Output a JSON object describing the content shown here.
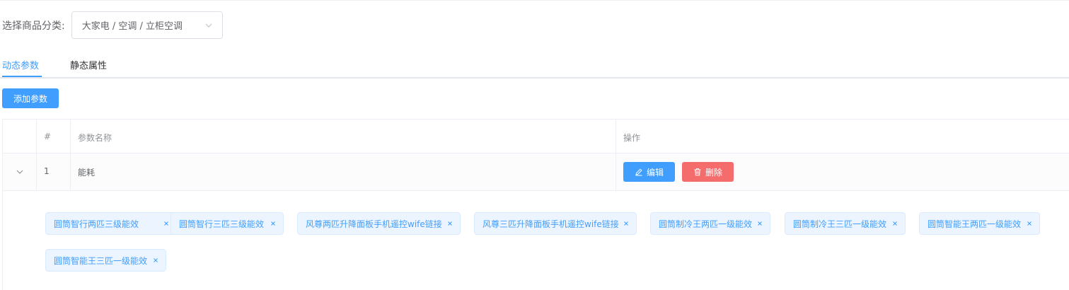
{
  "category": {
    "label": "选择商品分类:",
    "value": "大家电 / 空调 / 立柜空调",
    "icon": "chevron-down-icon"
  },
  "tabs": [
    {
      "label": "动态参数",
      "active": true
    },
    {
      "label": "静态属性",
      "active": false
    }
  ],
  "add_button": "添加参数",
  "table": {
    "headers": {
      "index": "#",
      "name": "参数名称",
      "actions": "操作"
    },
    "rows": [
      {
        "index": "1",
        "name": "能耗",
        "expanded": true,
        "edit_label": "编辑",
        "delete_label": "删除",
        "tags": [
          "圆筒智行两匹三级能效",
          "圆筒智行三匹三级能效",
          "风尊两匹升降面板手机遥控wife链接",
          "风尊三匹升降面板手机遥控wife链接",
          "圆筒制冷王两匹一级能效",
          "圆筒制冷王三匹一级能效",
          "圆筒智能王两匹一级能效",
          "圆筒智能王三匹一级能效"
        ]
      }
    ]
  },
  "colors": {
    "primary": "#409eff",
    "danger": "#f56c6c",
    "tag_bg": "#ecf5ff",
    "tag_border": "#d9ecff"
  }
}
